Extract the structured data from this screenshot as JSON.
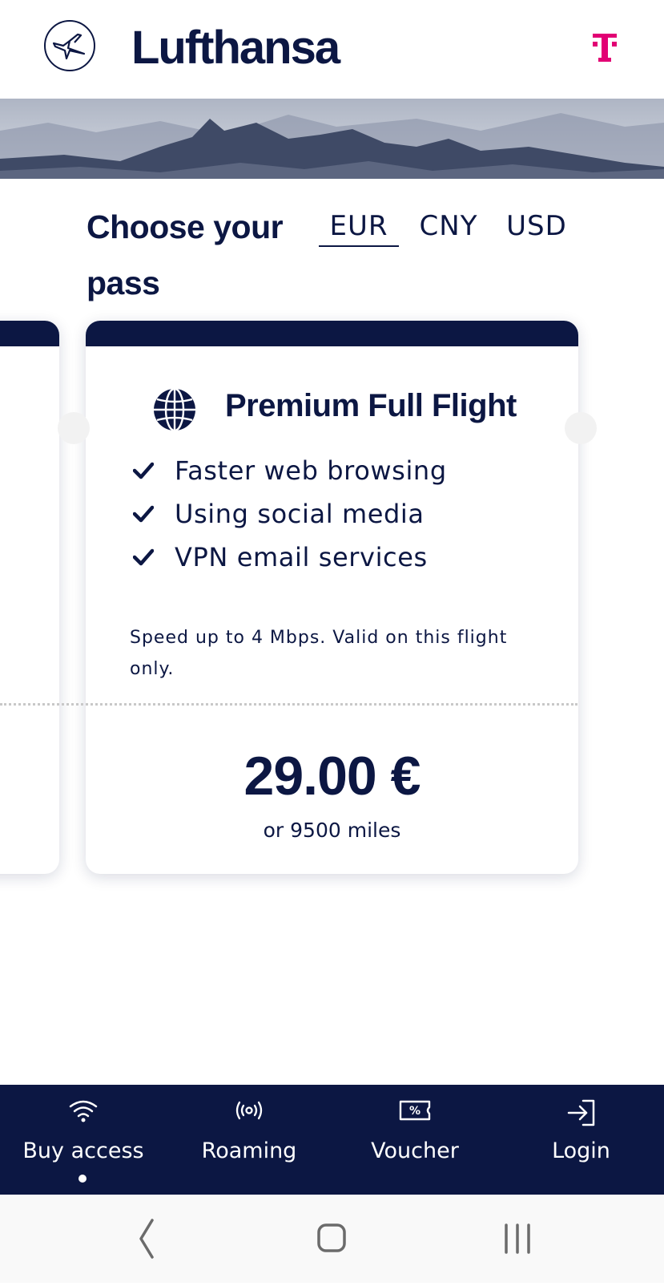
{
  "header": {
    "brand": "Lufthansa",
    "logo_icon": "crane-logo-icon",
    "partner_icon": "telekom-t-icon",
    "partner_color": "#e20074"
  },
  "main": {
    "title": "Choose your pass",
    "currencies": [
      {
        "label": "EUR",
        "selected": true
      },
      {
        "label": "CNY",
        "selected": false
      },
      {
        "label": "USD",
        "selected": false
      }
    ]
  },
  "plan": {
    "icon": "globe-icon",
    "title": "Premium Full Flight",
    "features": [
      "Faster web browsing",
      "Using social media",
      "VPN email services"
    ],
    "description": "Speed up to 4 Mbps. Valid on this flight only.",
    "price": "29.00 €",
    "miles": "or 9500 miles"
  },
  "bottom_nav": {
    "items": [
      {
        "label": "Buy access",
        "icon": "wifi-icon",
        "active": true
      },
      {
        "label": "Roaming",
        "icon": "broadcast-icon",
        "active": false
      },
      {
        "label": "Voucher",
        "icon": "voucher-icon",
        "active": false
      },
      {
        "label": "Login",
        "icon": "login-icon",
        "active": false
      }
    ]
  },
  "system_nav": {
    "buttons": [
      "back-icon",
      "home-icon",
      "recent-apps-icon"
    ]
  },
  "colors": {
    "primary": "#0c1743",
    "background": "#ffffff",
    "accent_partner": "#e20074"
  }
}
